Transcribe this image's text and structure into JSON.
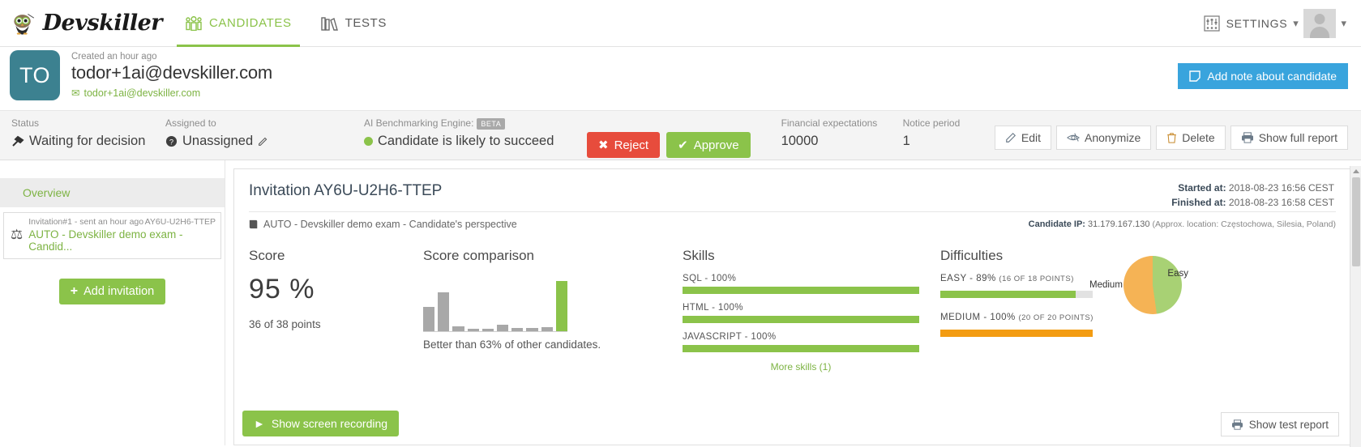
{
  "topnav": {
    "logo_text": "Devskiller",
    "logo_icon": "owl-logo-icon",
    "items": [
      {
        "label": "CANDIDATES",
        "icon": "people-group-icon",
        "active": true
      },
      {
        "label": "TESTS",
        "icon": "books-icon",
        "active": false
      }
    ],
    "settings_label": "SETTINGS",
    "settings_icon": "sliders-icon",
    "caret": "⌄"
  },
  "candidate": {
    "initials": "TO",
    "created": "Created an hour ago",
    "email_title": "todor+1ai@devskiller.com",
    "email_link": "todor+1ai@devskiller.com",
    "mail_icon": "✉",
    "add_note_label": "Add note about candidate",
    "add_note_icon": "note-icon"
  },
  "statusbar": {
    "status_label": "Status",
    "status_value": "Waiting for decision",
    "status_icon": "hammer-icon",
    "assigned_label": "Assigned to",
    "assigned_value": "Unassigned",
    "assigned_icon": "question-circle-icon",
    "assigned_edit_icon": "edit-icon",
    "ai_label": "AI Benchmarking Engine:",
    "ai_badge": "BETA",
    "ai_value": "Candidate is likely to succeed",
    "reject_label": "Reject",
    "reject_icon": "✖",
    "approve_label": "Approve",
    "approve_icon": "✔",
    "financial_label": "Financial expectations",
    "financial_value": "10000",
    "notice_label": "Notice period",
    "notice_value": "1",
    "actions": [
      {
        "label": "Edit",
        "icon": "edit-icon"
      },
      {
        "label": "Anonymize",
        "icon": "eye-slash-icon"
      },
      {
        "label": "Delete",
        "icon": "trash-icon"
      },
      {
        "label": "Show full report",
        "icon": "printer-icon"
      }
    ]
  },
  "sidebar": {
    "overview_label": "Overview",
    "invitation": {
      "meta": "Invitation#1 - sent an hour ago",
      "code": "AY6U-U2H6-TTEP",
      "title": "AUTO - Devskiller demo exam - Candid...",
      "icon": "scales-icon"
    },
    "add_invitation_label": "Add invitation",
    "add_invitation_icon": "+"
  },
  "panel": {
    "title": "Invitation AY6U-U2H6-TTEP",
    "started_label": "Started at:",
    "started_value": "2018-08-23 16:56 CEST",
    "finished_label": "Finished at:",
    "finished_value": "2018-08-23 16:58 CEST",
    "exam_name": "AUTO - Devskiller demo exam - Candidate's perspective",
    "exam_icon": "book-icon",
    "ip_label": "Candidate IP:",
    "ip_value": "31.179.167.130",
    "ip_sub": "(Approx. location: Częstochowa, Silesia, Poland)",
    "score_heading": "Score",
    "score_value": "95 %",
    "score_points": "36 of 38 points",
    "comparison_heading": "Score comparison",
    "comparison_text": "Better than 63% of other candidates.",
    "skills_heading": "Skills",
    "more_skills_label": "More skills (1)",
    "difficulties_heading": "Difficulties",
    "show_recording_label": "Show screen recording",
    "show_recording_icon": "play-icon",
    "show_test_report_label": "Show test report",
    "show_test_report_icon": "printer-icon"
  },
  "colors": {
    "green": "#8bc34a",
    "green_light": "#a8d174",
    "orange": "#f39c12",
    "orange_light": "#f5b355",
    "blue": "#39a4dd",
    "red": "#e74c3c",
    "teal": "#3c8190",
    "grey_track": "#e2e2e2"
  },
  "chart_data": [
    {
      "type": "bar",
      "title": "Score comparison",
      "categories": [
        "b1",
        "b2",
        "b3",
        "b4",
        "b5",
        "b6",
        "b7",
        "b8",
        "b9",
        "b10"
      ],
      "values": [
        30,
        48,
        6,
        3,
        3,
        8,
        4,
        4,
        5,
        62
      ],
      "highlight_index": 9,
      "annotation": "Better than 63% of other candidates.",
      "ylim": [
        0,
        62
      ],
      "grid": false
    },
    {
      "type": "bar",
      "title": "Skills",
      "orientation": "horizontal",
      "categories": [
        "SQL",
        "HTML",
        "JAVASCRIPT"
      ],
      "values": [
        100,
        100,
        100
      ],
      "labels": [
        "SQL - 100%",
        "HTML - 100%",
        "JAVASCRIPT - 100%"
      ],
      "xlim": [
        0,
        100
      ],
      "note": "More skills (1)"
    },
    {
      "type": "bar",
      "title": "Difficulties",
      "orientation": "horizontal",
      "categories": [
        "EASY",
        "MEDIUM"
      ],
      "values": [
        89,
        100
      ],
      "labels": [
        "EASY - 89%",
        "MEDIUM - 100%"
      ],
      "sublabels": [
        "(16 OF 18 POINTS)",
        "(20 OF 20 POINTS)"
      ],
      "colors": [
        "#8bc34a",
        "#f39c12"
      ],
      "xlim": [
        0,
        100
      ]
    },
    {
      "type": "pie",
      "title": "Difficulties distribution",
      "labels": [
        "Easy",
        "Medium"
      ],
      "values": [
        48,
        52
      ],
      "colors": [
        "#a8d174",
        "#f5b355"
      ]
    }
  ],
  "skills": [
    {
      "label": "SQL - 100%",
      "percent": 100
    },
    {
      "label": "HTML - 100%",
      "percent": 100
    },
    {
      "label": "JAVASCRIPT - 100%",
      "percent": 100
    }
  ],
  "difficulties": [
    {
      "label": "EASY - 89%",
      "points": "(16 OF 18 POINTS)",
      "percent": 89,
      "color": "#8bc34a"
    },
    {
      "label": "MEDIUM - 100%",
      "points": "(20 OF 20 POINTS)",
      "percent": 100,
      "color": "#f39c12"
    }
  ]
}
